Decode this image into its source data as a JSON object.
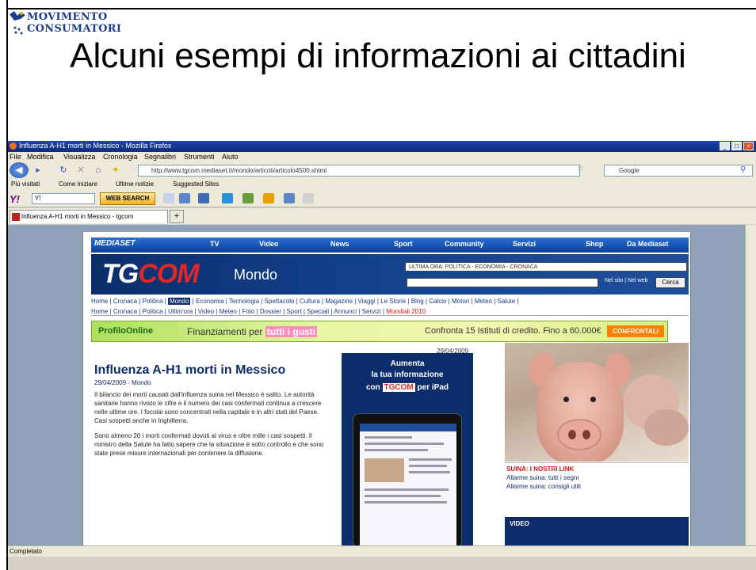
{
  "slide": {
    "logo_line1": "MOVIMENTO",
    "logo_line2": "CONSUMATORI",
    "title": "Alcuni esempi di informazioni ai cittadini"
  },
  "browser": {
    "window_title": "Influenza A-H1 morti in Messico - Mozilla Firefox",
    "menu": [
      "File",
      "Modifica",
      "Visualizza",
      "Cronologia",
      "Segnalibri",
      "Strumenti",
      "Aiuto"
    ],
    "url": "http://www.tgcom.mediaset.it/mondo/articoli/articolo4500.shtml",
    "search_placeholder": "Google",
    "bookmarks": [
      "Più visitati",
      "Come iniziare",
      "Ultime notizie",
      "Suggested Sites"
    ],
    "toolbar_input": "Y!",
    "toolbar_search": "WEB SEARCH",
    "tab_label": "Influenza A-H1 morti in Messico - tgcom",
    "tab_new": "+",
    "status": "Completato",
    "icons": {
      "back": "back-arrow-icon",
      "forward": "forward-arrow-icon",
      "reload": "reload-icon",
      "stop": "stop-icon",
      "home": "home-icon"
    }
  },
  "site": {
    "mediaset_logo": "MEDIASET",
    "nav": [
      "TV",
      "Video",
      "News",
      "Sport",
      "Community",
      "Servizi",
      "Shop",
      "Da Mediaset"
    ],
    "tgcom_logo_a": "TG",
    "tgcom_logo_b": "COM",
    "section": "Mondo",
    "ticker": "ULTIMA ORA: POLITICA - ECONOMIA - CRONACA",
    "search_button": "Cerca",
    "search_option": "Nel sito | Nel web",
    "nav1": "Home | Cronaca | Politica |",
    "nav1_active": "Mondo",
    "nav1_rest": "| Economia | Tecnologia | Spettacolo | Cultura | Magazine | Viaggi | Le Storie | Blog | Calcio | Motori | Meteo | Salute |",
    "nav2": "Home | Cronaca | Politica | Ultim'ora | Video | Meteo | Foto | Dossier | Sport | Speciali | Annunci | Servizi |",
    "nav2_red": "Mondiali 2010",
    "banner_brand": "ProfiloOnline",
    "banner_text": "Finanziamenti per",
    "banner_highlight": "tutti i gusti",
    "banner_right": "Confronta 15 Istituti di credito. Fino a 60.000€",
    "banner_cta": "CONFRONTALI",
    "date": "29/04/2009",
    "article_title": "Influenza A-H1 morti in Messico",
    "article_meta": "29/04/2009 - Mondo",
    "article_p1": "Il bilancio dei morti causati dall'influenza suina nel Messico è salito. Le autorità sanitarie hanno rivisto le cifre e il numero dei casi confermati continua a crescere nelle ultime ore. I focolai sono concentrati nella capitale e in altri stati del Paese. Casi sospetti anche in Inghilterra.",
    "article_p2": "Sono almeno 20 i morti confermati dovuti al virus e oltre mille i casi sospetti. Il ministro della Salute ha fatto sapere che la situazione è sotto controllo e che sono state prese misure internazionali per contenere la diffusione.",
    "promo_l1": "Aumenta",
    "promo_l2": "la tua informazione",
    "promo_l3a": "con",
    "promo_l3b": "TGCOM",
    "promo_l3c": "per iPad",
    "photo_head": "SUINA: I NOSTRI LINK",
    "photo_link1": "Allarme suina: tutti i segni",
    "photo_link2": "Allarme suina: consigli utili",
    "video_label": "VIDEO"
  }
}
